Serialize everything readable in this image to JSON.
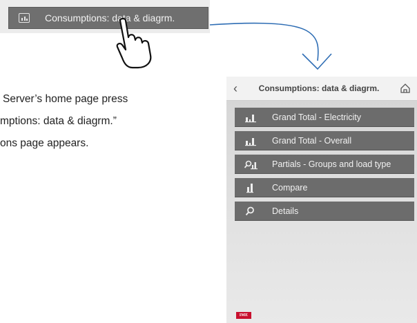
{
  "top_button": {
    "label": "Consumptions: data & diagrm.",
    "icon": "chart-icon"
  },
  "instructions": {
    "line1": "Server’s home page press",
    "line2": "mptions: data & diagrm.”",
    "line3": "ons page appears."
  },
  "phone": {
    "header": {
      "back_icon": "chevron-left-icon",
      "title": "Consumptions: data & diagrm.",
      "home_icon": "home-icon"
    },
    "menu": [
      {
        "label": "Grand Total - Electricity",
        "icon": "bar-chart-icon"
      },
      {
        "label": "Grand Total - Overall",
        "icon": "bar-chart-icon"
      },
      {
        "label": "Partials - Groups and load type",
        "icon": "search-bar-chart-icon"
      },
      {
        "label": "Compare",
        "icon": "compare-bars-icon"
      },
      {
        "label": "Details",
        "icon": "search-icon"
      }
    ],
    "logo": "IME"
  },
  "colors": {
    "button": "#6c6c6c",
    "arrow": "#2e6db4",
    "logo": "#c8102e"
  }
}
